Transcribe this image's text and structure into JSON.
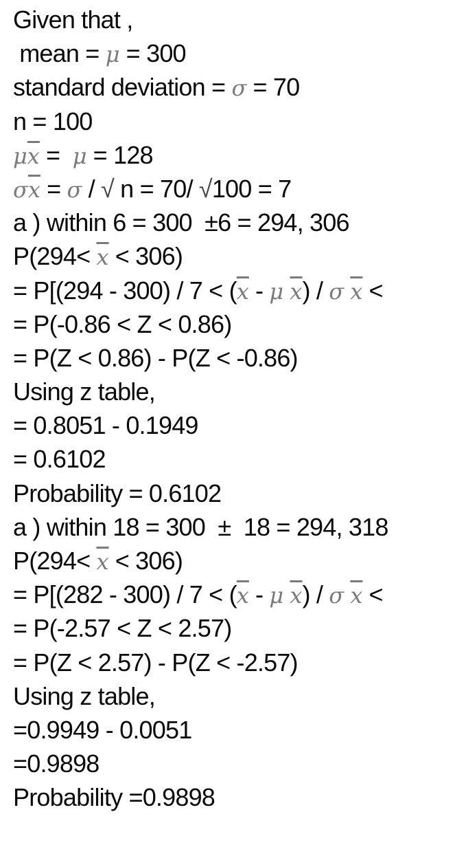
{
  "lines": [
    {
      "parts": [
        {
          "t": "Given that ,"
        }
      ]
    },
    {
      "parts": [
        {
          "t": " mean = "
        },
        {
          "m": "μ"
        },
        {
          "t": " = 300"
        }
      ]
    },
    {
      "parts": [
        {
          "t": "standard deviation = "
        },
        {
          "m": "σ"
        },
        {
          "t": " = 70"
        }
      ]
    },
    {
      "parts": [
        {
          "t": "n = 100"
        }
      ]
    },
    {
      "parts": [
        {
          "m": "μ"
        },
        {
          "m": "x",
          "bar": true
        },
        {
          "t": " =  "
        },
        {
          "m": "μ"
        },
        {
          "t": " = 128"
        }
      ]
    },
    {
      "parts": [
        {
          "m": "σ"
        },
        {
          "m": "x",
          "bar": true
        },
        {
          "t": " = "
        },
        {
          "m": "σ"
        },
        {
          "t": " / "
        },
        {
          "s": "√"
        },
        {
          "t": " n = 70/ "
        },
        {
          "s": "√"
        },
        {
          "t": "100 = 7"
        }
      ]
    },
    {
      "parts": [
        {
          "t": "a ) within 6 = 300  ±6 = 294, 306"
        }
      ]
    },
    {
      "parts": [
        {
          "t": "P(294< "
        },
        {
          "m": "x",
          "bar": true
        },
        {
          "t": " < 306)"
        }
      ]
    },
    {
      "parts": [
        {
          "t": "= P[(294 - 300) / 7 < ("
        },
        {
          "m": "x",
          "bar": true
        },
        {
          "t": " - "
        },
        {
          "m": "μ"
        },
        {
          "t": " "
        },
        {
          "m": "x",
          "bar": true
        },
        {
          "t": ") / "
        },
        {
          "m": "σ"
        },
        {
          "t": " "
        },
        {
          "m": "x",
          "bar": true
        },
        {
          "t": " <"
        }
      ]
    },
    {
      "parts": [
        {
          "t": "= P(-0.86 < Z < 0.86)"
        }
      ]
    },
    {
      "parts": [
        {
          "t": "= P(Z < 0.86) - P(Z < -0.86)"
        }
      ]
    },
    {
      "parts": [
        {
          "t": "Using z table,"
        }
      ]
    },
    {
      "parts": [
        {
          "t": "= 0.8051 - 0.1949"
        }
      ]
    },
    {
      "parts": [
        {
          "t": "= 0.6102"
        }
      ]
    },
    {
      "parts": [
        {
          "t": "Probability = 0.6102"
        }
      ]
    },
    {
      "parts": [
        {
          "t": "a ) within 18 = 300  ±  18 = 294, 318"
        }
      ]
    },
    {
      "parts": [
        {
          "t": "P(294< "
        },
        {
          "m": "x",
          "bar": true
        },
        {
          "t": " < 306)"
        }
      ]
    },
    {
      "parts": [
        {
          "t": "= P[(282 - 300) / 7 < ("
        },
        {
          "m": "x",
          "bar": true
        },
        {
          "t": " - "
        },
        {
          "m": "μ"
        },
        {
          "t": " "
        },
        {
          "m": "x",
          "bar": true
        },
        {
          "t": ") / "
        },
        {
          "m": "σ"
        },
        {
          "t": " "
        },
        {
          "m": "x",
          "bar": true
        },
        {
          "t": " <"
        }
      ]
    },
    {
      "parts": [
        {
          "t": "= P(-2.57 < Z < 2.57)"
        }
      ]
    },
    {
      "parts": [
        {
          "t": "= P(Z < 2.57) - P(Z < -2.57)"
        }
      ]
    },
    {
      "parts": [
        {
          "t": "Using z table,"
        }
      ]
    },
    {
      "parts": [
        {
          "t": "=0.9949 - 0.0051"
        }
      ]
    },
    {
      "parts": [
        {
          "t": "=0.9898"
        }
      ]
    },
    {
      "parts": [
        {
          "t": "Probability =0.9898"
        }
      ]
    }
  ]
}
